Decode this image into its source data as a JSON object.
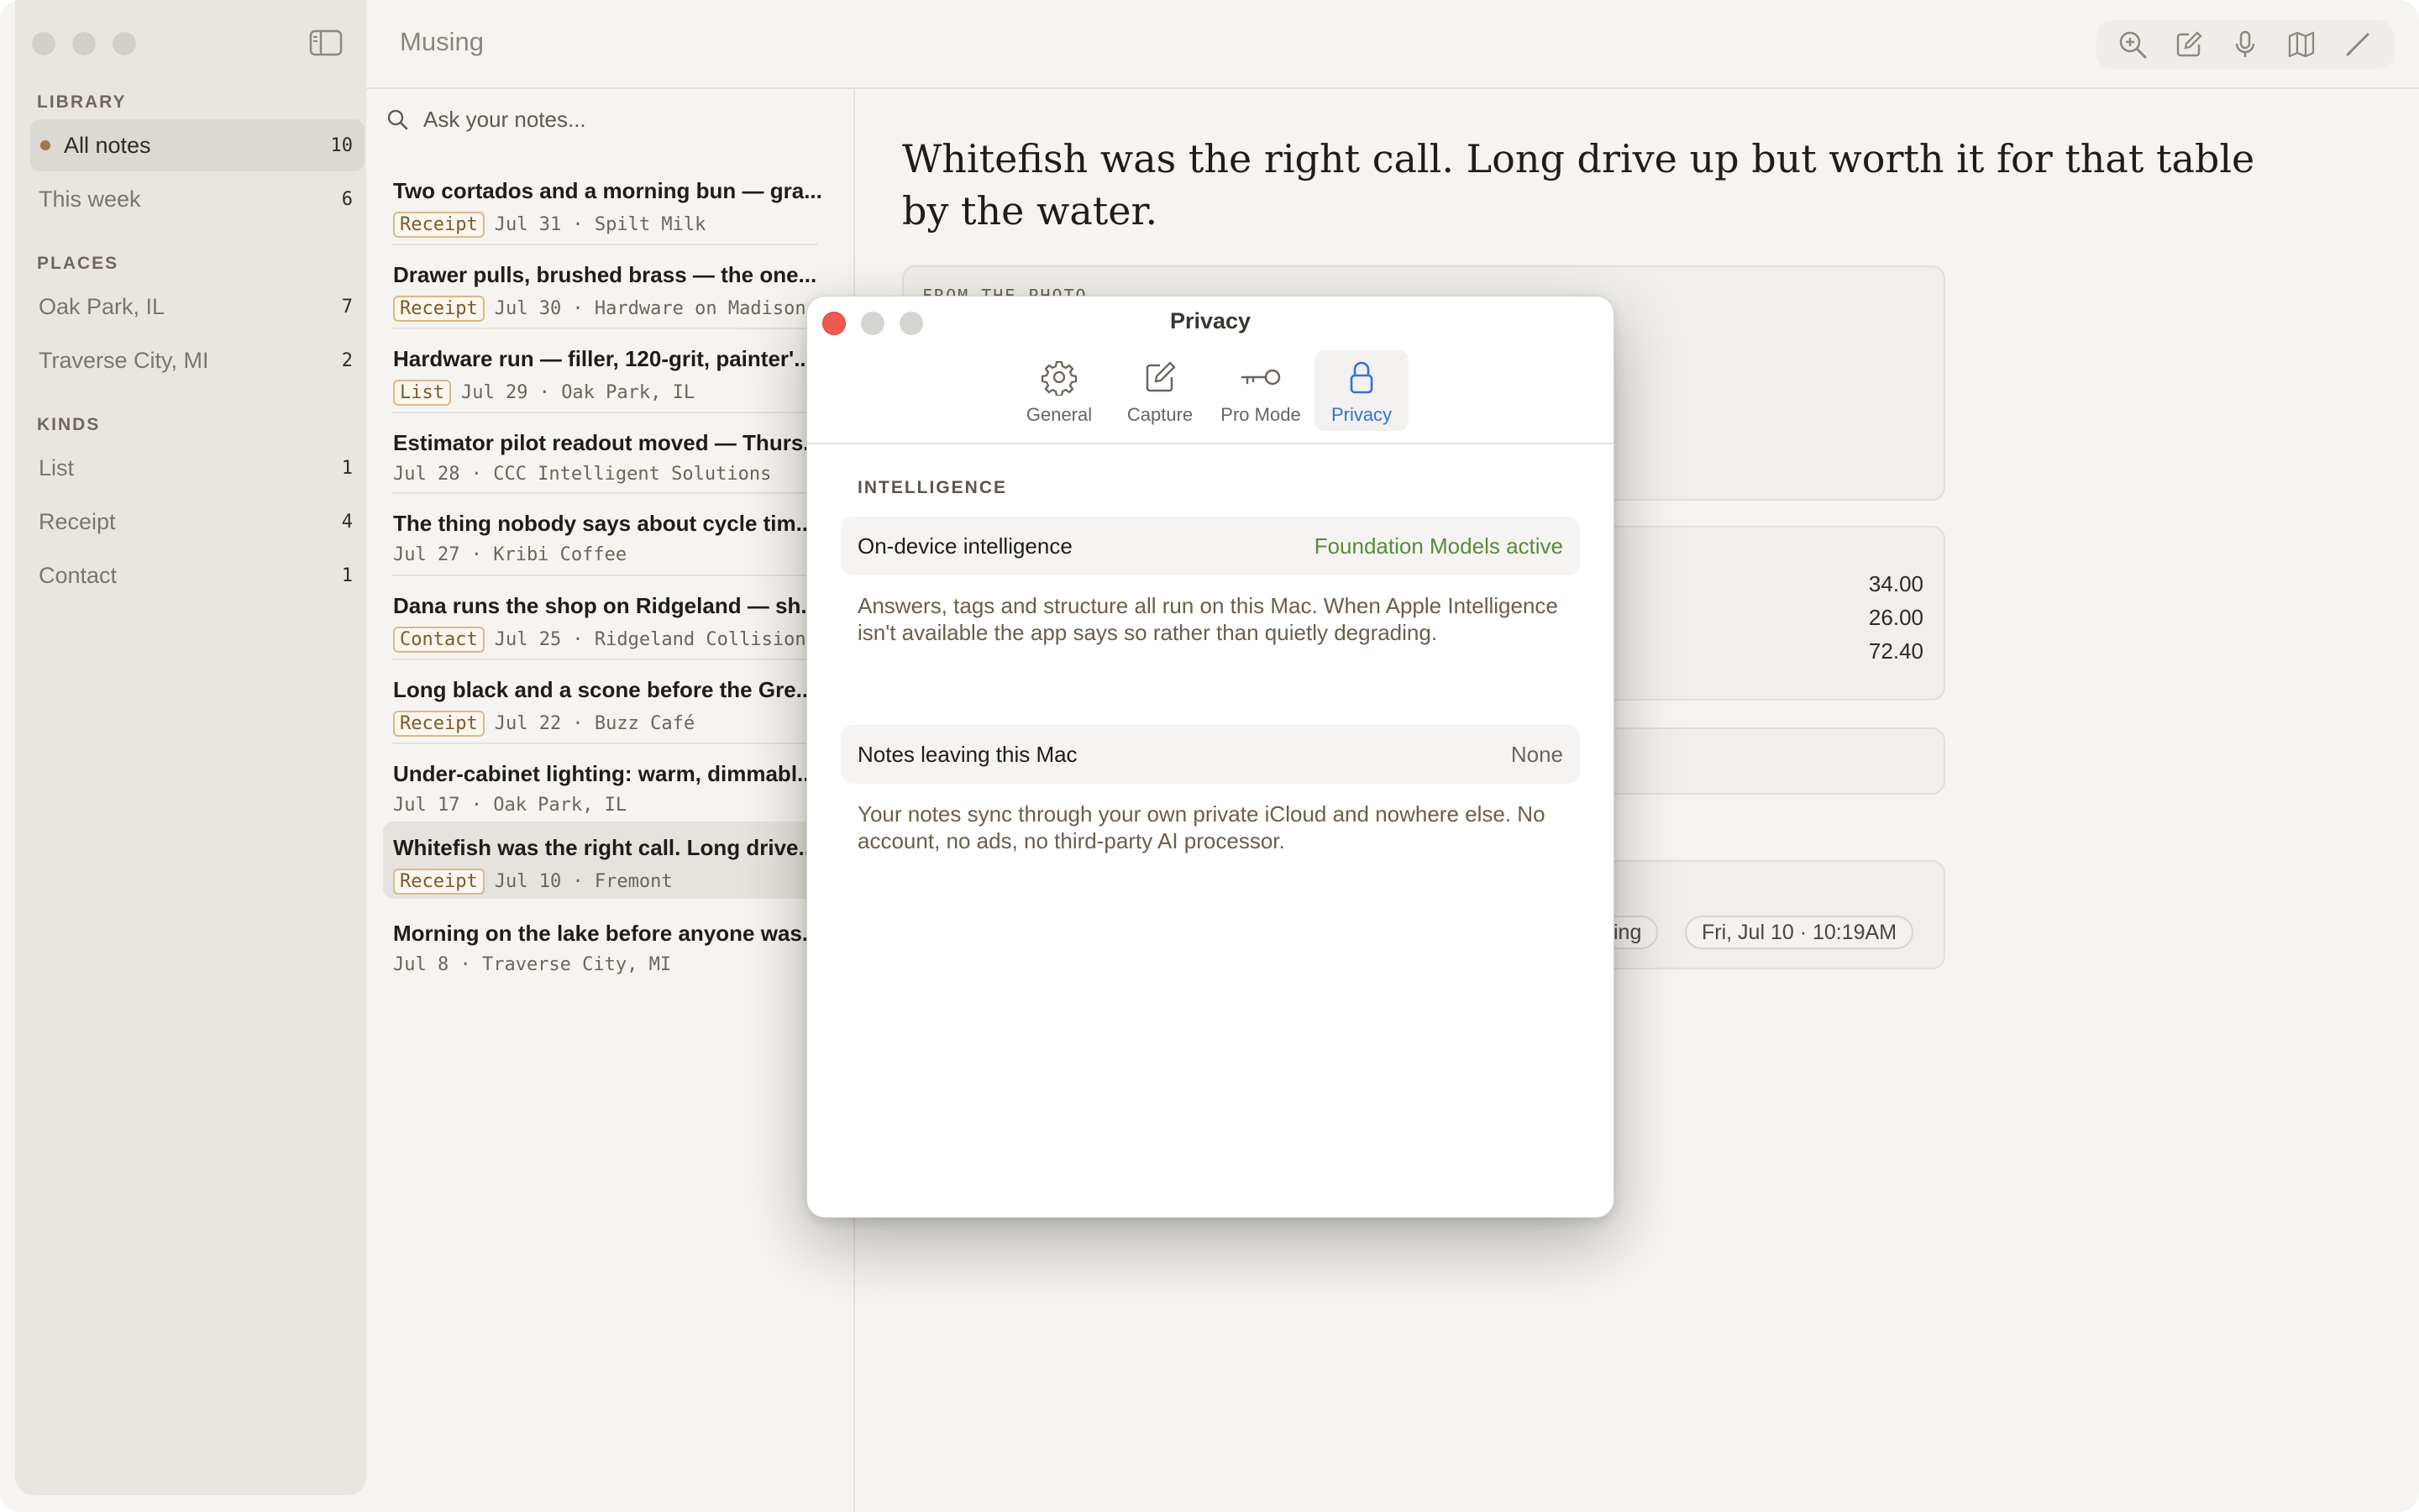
{
  "app": {
    "title": "Musing"
  },
  "sidebar": {
    "sections": [
      {
        "header": "LIBRARY",
        "items": [
          {
            "label": "All notes",
            "count": "10",
            "selected": true
          },
          {
            "label": "This week",
            "count": "6"
          }
        ]
      },
      {
        "header": "PLACES",
        "items": [
          {
            "label": "Oak Park, IL",
            "count": "7"
          },
          {
            "label": "Traverse City, MI",
            "count": "2"
          }
        ]
      },
      {
        "header": "KINDS",
        "items": [
          {
            "label": "List",
            "count": "1"
          },
          {
            "label": "Receipt",
            "count": "4"
          },
          {
            "label": "Contact",
            "count": "1"
          }
        ]
      }
    ]
  },
  "toolbar": {
    "icons": [
      "zoom-in-icon",
      "compose-icon",
      "microphone-icon",
      "map-icon",
      "pencil-icon"
    ]
  },
  "search": {
    "placeholder": "Ask your notes..."
  },
  "notes": [
    {
      "title": "Two cortados and a morning bun — gra...",
      "tag": "Receipt",
      "meta": "Jul 31 · Spilt Milk"
    },
    {
      "title": "Drawer pulls, brushed brass — the one...",
      "tag": "Receipt",
      "meta": "Jul 30 · Hardware on Madison"
    },
    {
      "title": "Hardware run — filler, 120-grit, painter'...",
      "tag": "List",
      "meta": "Jul 29 · Oak Park, IL"
    },
    {
      "title": "Estimator pilot readout moved — Thurs...",
      "tag": "",
      "meta": "Jul 28 · CCC Intelligent Solutions"
    },
    {
      "title": "The thing nobody says about cycle tim...",
      "tag": "",
      "meta": "Jul 27 · Kribi Coffee"
    },
    {
      "title": "Dana runs the shop on Ridgeland — sh...",
      "tag": "Contact",
      "meta": "Jul 25 · Ridgeland Collision"
    },
    {
      "title": "Long black and a scone before the Gre...",
      "tag": "Receipt",
      "meta": "Jul 22 · Buzz Café"
    },
    {
      "title": "Under-cabinet lighting: warm, dimmabl...",
      "tag": "",
      "meta": "Jul 17 · Oak Park, IL"
    },
    {
      "title": "Whitefish was the right call. Long drive...",
      "tag": "Receipt",
      "meta": "Jul 10 · Fremont",
      "selected": true
    },
    {
      "title": "Morning on the lake before anyone was...",
      "tag": "",
      "meta": "Jul 8 · Traverse City, MI"
    }
  ],
  "detail": {
    "title": "Whitefish was the right call. Long drive up but worth it for that table by the water.",
    "photo_header": "FROM THE PHOTO",
    "amounts": [
      "34.00",
      "26.00",
      "72.40"
    ],
    "chips": [
      "…ing",
      "Fri, Jul 10 · 10:19AM"
    ]
  },
  "dialog": {
    "title": "Privacy",
    "tabs": [
      {
        "label": "General",
        "icon": "gear-icon"
      },
      {
        "label": "Capture",
        "icon": "compose-icon"
      },
      {
        "label": "Pro Mode",
        "icon": "key-icon"
      },
      {
        "label": "Privacy",
        "icon": "lock-icon",
        "active": true
      }
    ],
    "section": "INTELLIGENCE",
    "rows": [
      {
        "label": "On-device intelligence",
        "value": "Foundation Models active",
        "value_color": "#5a8a3a"
      },
      {
        "label": "Notes leaving this Mac",
        "value": "None",
        "value_color": "#6b655d"
      }
    ],
    "notes": [
      "Answers, tags and structure all run on this Mac. When Apple Intelligence isn't available the app says so rather than quietly degrading.",
      "Your notes sync through your own private iCloud and nowhere else. No account, no ads, no third-party AI processor."
    ]
  },
  "colors": {
    "accent_blue": "#2f73d9",
    "active_green": "#5a8a3a",
    "close_red": "#ee5a52"
  }
}
